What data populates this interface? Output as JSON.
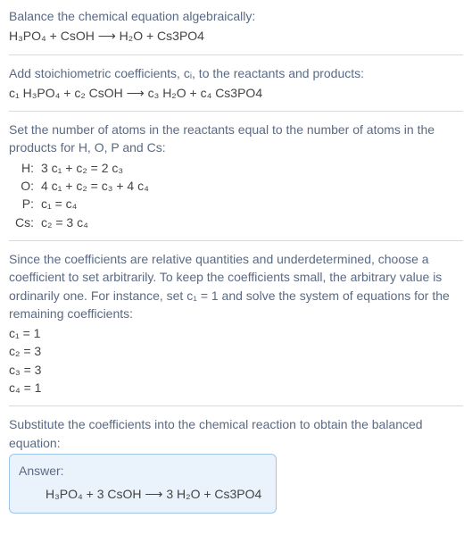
{
  "prompt_line": "Balance the chemical equation algebraically:",
  "orig_equation": "H₃PO₄ + CsOH ⟶ H₂O + Cs3PO4",
  "step_add_coeffs": "Add stoichiometric coefficients, cᵢ, to the reactants and products:",
  "coeff_equation": "c₁ H₃PO₄ + c₂ CsOH ⟶ c₃ H₂O + c₄ Cs3PO4",
  "step_set_atoms": "Set the number of atoms in the reactants equal to the number of atoms in the products for H, O, P and Cs:",
  "atom_rows": [
    {
      "el": "H:",
      "eq": "3 c₁ + c₂ = 2 c₃"
    },
    {
      "el": "O:",
      "eq": "4 c₁ + c₂ = c₃ + 4 c₄"
    },
    {
      "el": "P:",
      "eq": "c₁ = c₄"
    },
    {
      "el": "Cs:",
      "eq": "c₂ = 3 c₄"
    }
  ],
  "step_choose": "Since the coefficients are relative quantities and underdetermined, choose a coefficient to set arbitrarily. To keep the coefficients small, the arbitrary value is ordinarily one. For instance, set c₁ = 1 and solve the system of equations for the remaining coefficients:",
  "coeff_values": [
    "c₁ = 1",
    "c₂ = 3",
    "c₃ = 3",
    "c₄ = 1"
  ],
  "step_substitute": "Substitute the coefficients into the chemical reaction to obtain the balanced equation:",
  "answer_label": "Answer:",
  "answer_equation": "H₃PO₄ + 3 CsOH ⟶ 3 H₂O + Cs3PO4"
}
